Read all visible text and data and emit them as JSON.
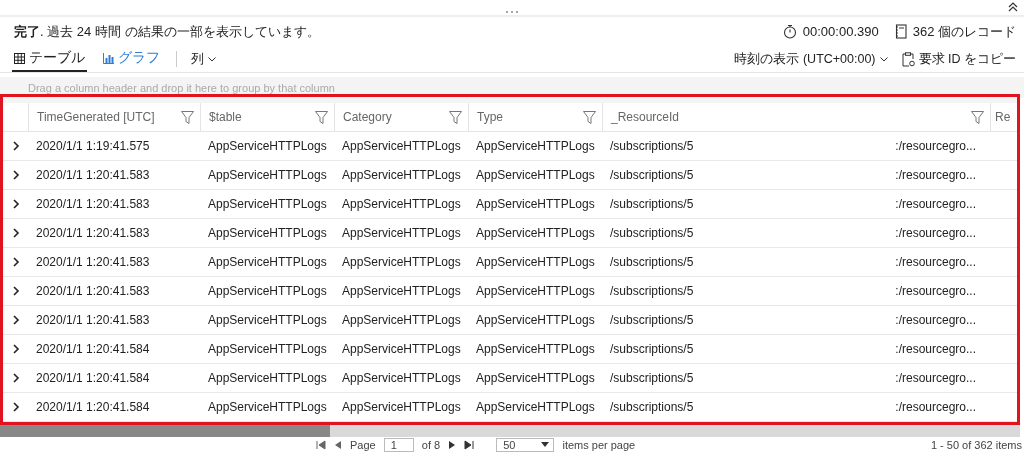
{
  "summary": {
    "message": "**完了**. 過去 24 時間 の結果の一部を表示しています。",
    "duration": "00:00:00.390",
    "records": "362 個のレコード"
  },
  "tabs": [
    {
      "label": "テーブル",
      "kind": "table",
      "selected": true
    },
    {
      "label": "グラフ",
      "kind": "chart",
      "selected": false
    }
  ],
  "columns_menu": "列",
  "time_display": "時刻の表示 (UTC+00:00)",
  "copy_request": "要求 ID をコピー",
  "group_hint": "Drag a column header and drop it here to group by that column",
  "table": {
    "columns": [
      "TimeGenerated [UTC]",
      "$table",
      "Category",
      "Type",
      "_ResourceId",
      "Re"
    ],
    "rows": [
      {
        "expanded": false,
        "time": "2020/1/1 1:19:41.575",
        "table": "AppServiceHTTPLogs",
        "category": "AppServiceHTTPLogs",
        "type": "AppServiceHTTPLogs",
        "resource_start": "/subscriptions/5",
        "resource_end": ":/resourcegro..."
      },
      {
        "expanded": false,
        "time": "2020/1/1 1:20:41.583",
        "table": "AppServiceHTTPLogs",
        "category": "AppServiceHTTPLogs",
        "type": "AppServiceHTTPLogs",
        "resource_start": "/subscriptions/5",
        "resource_end": ":/resourcegro..."
      },
      {
        "expanded": false,
        "time": "2020/1/1 1:20:41.583",
        "table": "AppServiceHTTPLogs",
        "category": "AppServiceHTTPLogs",
        "type": "AppServiceHTTPLogs",
        "resource_start": "/subscriptions/5",
        "resource_end": ":/resourcegro..."
      },
      {
        "expanded": false,
        "time": "2020/1/1 1:20:41.583",
        "table": "AppServiceHTTPLogs",
        "category": "AppServiceHTTPLogs",
        "type": "AppServiceHTTPLogs",
        "resource_start": "/subscriptions/5",
        "resource_end": ":/resourcegro..."
      },
      {
        "expanded": false,
        "time": "2020/1/1 1:20:41.583",
        "table": "AppServiceHTTPLogs",
        "category": "AppServiceHTTPLogs",
        "type": "AppServiceHTTPLogs",
        "resource_start": "/subscriptions/5",
        "resource_end": ":/resourcegro..."
      },
      {
        "expanded": false,
        "time": "2020/1/1 1:20:41.583",
        "table": "AppServiceHTTPLogs",
        "category": "AppServiceHTTPLogs",
        "type": "AppServiceHTTPLogs",
        "resource_start": "/subscriptions/5",
        "resource_end": ":/resourcegro..."
      },
      {
        "expanded": false,
        "time": "2020/1/1 1:20:41.583",
        "table": "AppServiceHTTPLogs",
        "category": "AppServiceHTTPLogs",
        "type": "AppServiceHTTPLogs",
        "resource_start": "/subscriptions/5",
        "resource_end": ":/resourcegro..."
      },
      {
        "expanded": false,
        "time": "2020/1/1 1:20:41.584",
        "table": "AppServiceHTTPLogs",
        "category": "AppServiceHTTPLogs",
        "type": "AppServiceHTTPLogs",
        "resource_start": "/subscriptions/5",
        "resource_end": ":/resourcegro..."
      },
      {
        "expanded": false,
        "time": "2020/1/1 1:20:41.584",
        "table": "AppServiceHTTPLogs",
        "category": "AppServiceHTTPLogs",
        "type": "AppServiceHTTPLogs",
        "resource_start": "/subscriptions/5",
        "resource_end": ":/resourcegro..."
      },
      {
        "expanded": false,
        "time": "2020/1/1 1:20:41.584",
        "table": "AppServiceHTTPLogs",
        "category": "AppServiceHTTPLogs",
        "type": "AppServiceHTTPLogs",
        "resource_start": "/subscriptions/5",
        "resource_end": ":/resourcegro..."
      }
    ]
  },
  "pager": {
    "page_label": "Page",
    "page": "1",
    "page_count": "of 8",
    "page_size": "50",
    "per_page": "items per page",
    "range": "1 - 50 of 362 items"
  }
}
